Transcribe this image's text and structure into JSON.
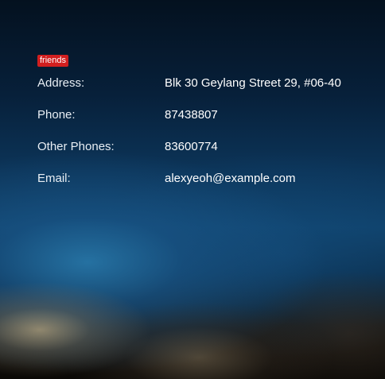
{
  "tags": [
    "friends"
  ],
  "details": [
    {
      "label": "Address:",
      "value": "Blk 30 Geylang Street 29, #06-40"
    },
    {
      "label": "Phone:",
      "value": "87438807"
    },
    {
      "label": "Other Phones:",
      "value": "83600774"
    },
    {
      "label": "Email:",
      "value": "alexyeoh@example.com"
    }
  ],
  "colors": {
    "tag_background": "#d21f1f",
    "text": "#ffffff"
  }
}
